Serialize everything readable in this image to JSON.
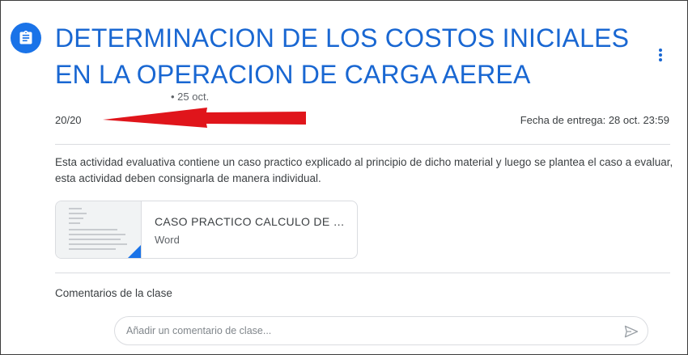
{
  "assignment": {
    "title": "DETERMINACION DE LOS COSTOS INICIALES EN LA OPERACION DE CARGA AEREA",
    "date": "• 25 oct.",
    "grade": "20/20",
    "due": "Fecha de entrega: 28 oct. 23:59",
    "description": "Esta actividad evaluativa contiene un caso practico explicado al principio de dicho material y luego se plantea el caso a evaluar, esta actividad deben consignarla de manera individual."
  },
  "attachment": {
    "title": "CASO PRACTICO CALCULO DE COSTOS",
    "type": "Word"
  },
  "comments": {
    "heading": "Comentarios de la clase",
    "placeholder": "Añadir un comentario de clase..."
  },
  "icons": {
    "assignment": "assignment-icon",
    "more": "more-vert-icon",
    "send": "send-icon",
    "annotation": "red-arrow-icon"
  },
  "colors": {
    "accent": "#1967d2",
    "icon_bg": "#1a73e8",
    "annotation": "#e0151b"
  }
}
